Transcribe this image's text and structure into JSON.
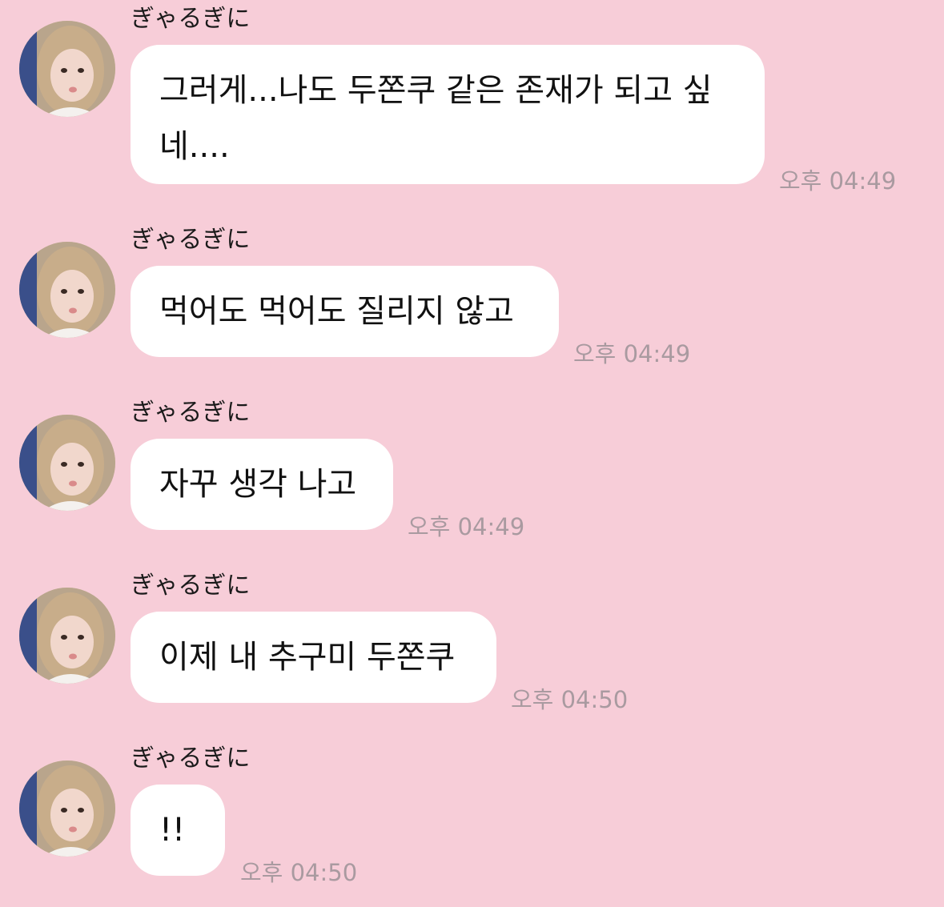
{
  "colors": {
    "background": "#f7cdd8",
    "bubble": "#ffffff",
    "timestamp": "#a99aa0"
  },
  "messages": [
    {
      "sender": "ぎゃるぎに",
      "text_lines": [
        "그러게...나도 두쫀쿠 같은 존재가 되고 싶",
        "네...."
      ],
      "time": "오후 04:49"
    },
    {
      "sender": "ぎゃるぎに",
      "text_lines": [
        "먹어도 먹어도 질리지 않고"
      ],
      "time": "오후 04:49"
    },
    {
      "sender": "ぎゃるぎに",
      "text_lines": [
        "자꾸 생각 나고"
      ],
      "time": "오후 04:49"
    },
    {
      "sender": "ぎゃるぎに",
      "text_lines": [
        "이제 내 추구미 두쫀쿠"
      ],
      "time": "오후 04:50"
    },
    {
      "sender": "ぎゃるぎに",
      "text_lines": [
        "!!"
      ],
      "time": "오후 04:50"
    }
  ]
}
